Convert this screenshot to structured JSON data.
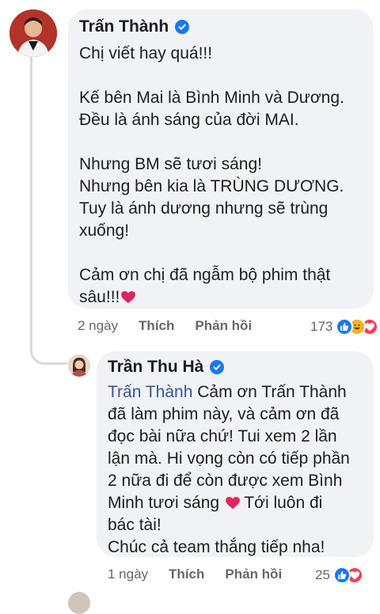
{
  "colors": {
    "bubble_bg": "#f0f2f5",
    "mention": "#385898",
    "verified": "#1877f2",
    "heart": "#e0245e",
    "meta_text": "#65676b"
  },
  "comment": {
    "author": "Trấn Thành",
    "verified_icon": "verified-badge-icon",
    "text": "Chị viết hay quá!!!\n\nKế bên Mai là Bình Minh và Dương.\nĐều là ánh sáng của đời MAI.\n\nNhưng BM sẽ tươi sáng!\nNhưng bên kia là TRÙNG DƯƠNG.\nTuy là ánh dương nhưng sẽ trùng\nxuống!\n\nCảm ơn chị đã ngẫm bộ phim thật\nsâu!!!",
    "time": "2 ngày",
    "like_label": "Thích",
    "reply_label": "Phản hồi",
    "reaction_count": "173"
  },
  "reply": {
    "author": "Trần Thu Hà",
    "verified_icon": "verified-badge-icon",
    "mention": "Trấn Thành",
    "text_part1": " Cảm ơn Trấn Thành\nđã làm phim này, và cảm ơn đã\nđọc bài nữa chứ! Tui xem 2 lần\nlận mà. Hi vọng còn có tiếp phần\n2 nữa đi để còn được xem Bình\nMinh tươi sáng ",
    "text_part2": " Tới luôn đi\nbác tài!\nChúc cả team thắng tiếp nha!",
    "time": "1 ngày",
    "like_label": "Thích",
    "reply_label": "Phản hồi",
    "reaction_count": "25"
  }
}
